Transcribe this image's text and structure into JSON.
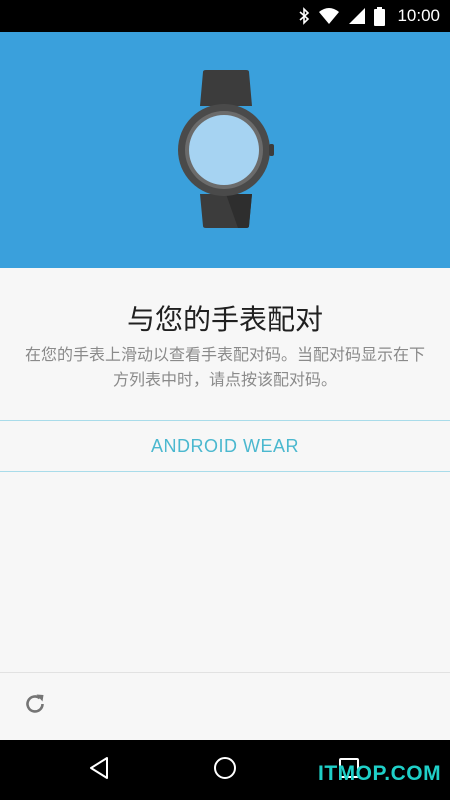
{
  "status_bar": {
    "time": "10:00",
    "icons": [
      "bluetooth-icon",
      "wifi-icon",
      "signal-icon",
      "battery-icon"
    ]
  },
  "hero": {
    "background_color": "#3aa0dc",
    "image": "smartwatch-illustration"
  },
  "content": {
    "title": "与您的手表配对",
    "description": "在您的手表上滑动以查看手表配对码。当配对码显示在下方列表中时，请点按该配对码。"
  },
  "devices": [
    {
      "label": "ANDROID WEAR"
    }
  ],
  "bottom_bar": {
    "refresh_icon": "refresh-icon"
  },
  "nav_bar": {
    "buttons": [
      "back-icon",
      "home-icon",
      "recents-icon"
    ]
  },
  "watermark": "ITMOP.COM",
  "colors": {
    "accent": "#4bb8cf",
    "divider": "#a9dcea",
    "hero": "#3aa0dc"
  }
}
